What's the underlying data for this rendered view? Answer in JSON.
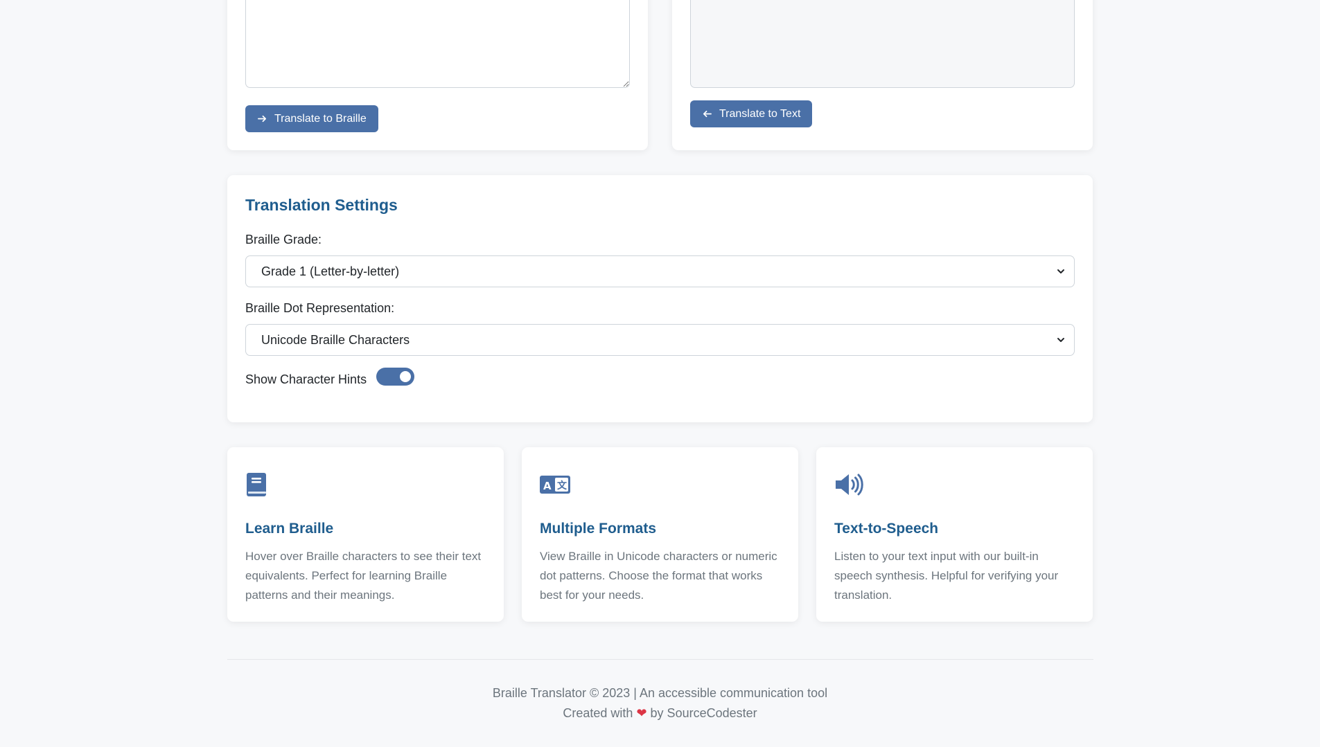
{
  "translate_panel": {
    "text_input": {
      "value": "",
      "placeholder": ""
    },
    "braille_output": {
      "value": "",
      "placeholder": ""
    },
    "to_braille_label": "Translate to Braille",
    "to_text_label": "Translate to Text"
  },
  "settings": {
    "title": "Translation Settings",
    "grade_label": "Braille Grade:",
    "grade_value": "Grade 1 (Letter-by-letter)",
    "dot_label": "Braille Dot Representation:",
    "dot_value": "Unicode Braille Characters",
    "hints_label": "Show Character Hints",
    "hints_enabled": true
  },
  "features": [
    {
      "icon": "book-icon",
      "title": "Learn Braille",
      "description": "Hover over Braille characters to see their text equivalents. Perfect for learning Braille patterns and their meanings."
    },
    {
      "icon": "language-icon",
      "title": "Multiple Formats",
      "description": "View Braille in Unicode characters or numeric dot patterns. Choose the format that works best for your needs."
    },
    {
      "icon": "volume-icon",
      "title": "Text-to-Speech",
      "description": "Listen to your text input with our built-in speech synthesis. Helpful for verifying your translation."
    }
  ],
  "footer": {
    "line1": "Braille Translator © 2023 | An accessible communication tool",
    "line2_prefix": "Created with",
    "line2_suffix": "by SourceCodester"
  },
  "colors": {
    "accent": "#4a70a7",
    "heading": "#1f5d8e",
    "background": "#f7f8fa",
    "heart": "#dc3545"
  }
}
